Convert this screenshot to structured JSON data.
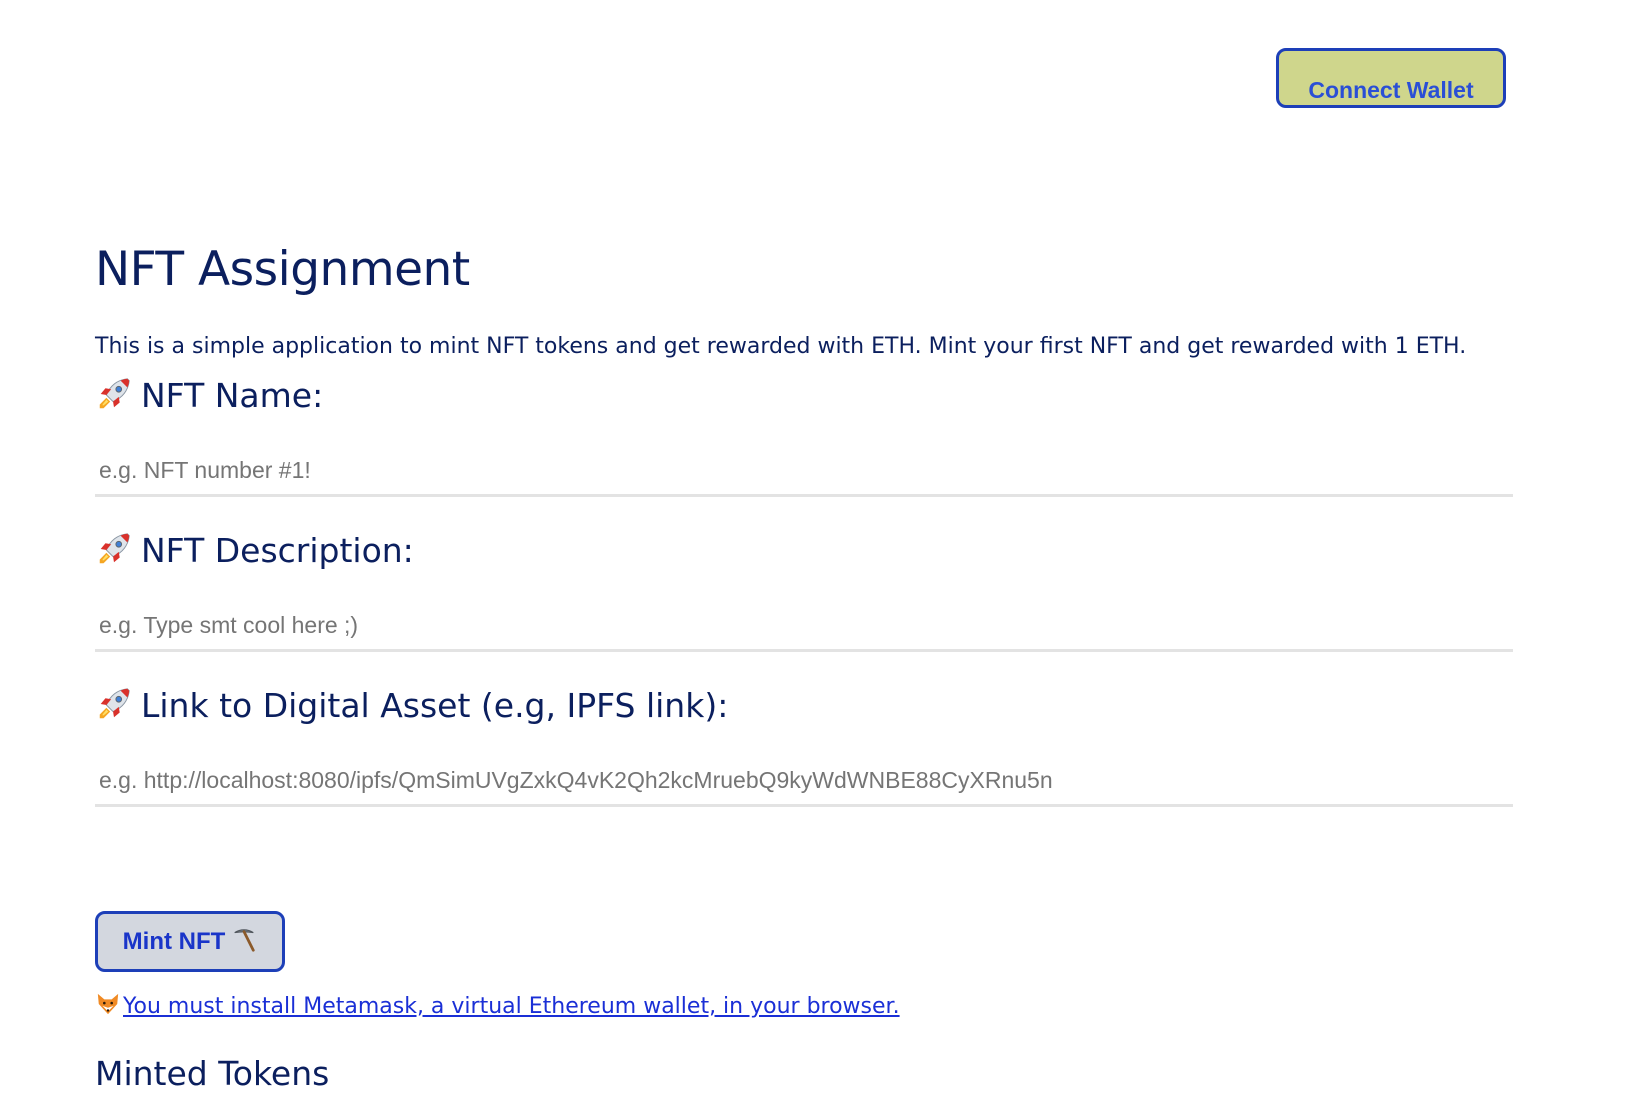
{
  "header": {
    "connect_wallet_label": "Connect Wallet"
  },
  "main": {
    "title": "NFT Assignment",
    "intro": "This is a simple application to mint NFT tokens and get rewarded with ETH. Mint your first NFT and get rewarded with 1 ETH.",
    "fields": [
      {
        "icon": "rocket-icon",
        "label": "NFT Name:",
        "value": "",
        "placeholder": "e.g. NFT number #1!"
      },
      {
        "icon": "rocket-icon",
        "label": "NFT Description:",
        "value": "",
        "placeholder": "e.g. Type smt cool here ;)"
      },
      {
        "icon": "rocket-icon",
        "label": "Link to Digital Asset (e.g, IPFS link):",
        "value": "",
        "placeholder": "e.g. http://localhost:8080/ipfs/QmSimUVgZxkQ4vK2Qh2kcMruebQ9kyWdWNBE88CyXRnu5n"
      }
    ],
    "mint_button_label": "Mint NFT",
    "mint_button_icon": "pick-icon",
    "status": {
      "icon": "fox-icon",
      "link_text": "You must install Metamask, a virtual Ethereum wallet, in your browser."
    },
    "minted_title": "Minted Tokens"
  },
  "colors": {
    "text": "#0b1f5e",
    "accent": "#1d3fb8",
    "wallet_bg": "#cfd68c",
    "mint_bg": "#d3d7df",
    "link": "#1a2fd6"
  }
}
